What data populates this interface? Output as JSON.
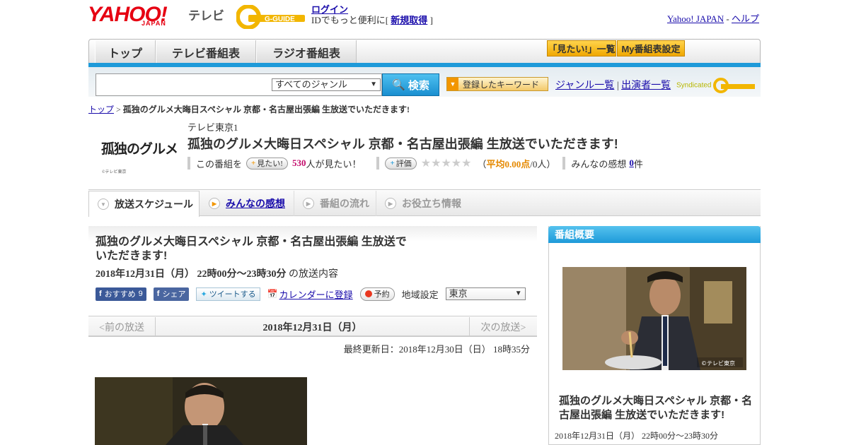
{
  "header": {
    "logo": "YAHOO!",
    "logo_sub": "JAPAN",
    "service": "テレビ",
    "gguide_logo": "G-GUIDE",
    "login_link": "ログイン",
    "login_text_prefix": "IDでもっと便利に[",
    "signup_link": "新規取得",
    "login_text_suffix": "]",
    "yahoo_japan_link": "Yahoo! JAPAN",
    "separator": "-",
    "help_link": "ヘルプ"
  },
  "nav": {
    "tabs": [
      "トップ",
      "テレビ番組表",
      "ラジオ番組表"
    ],
    "want_list": "「見たい!」一覧",
    "my_settings": "My番組表設定"
  },
  "search": {
    "input_value": "",
    "genre_selected": "すべてのジャンル",
    "search_button": "検索",
    "keyword_button": "登録したキーワード",
    "genre_list_link": "ジャンル一覧",
    "divider": "|",
    "performer_list_link": "出演者一覧",
    "syndicated": "Syndicated"
  },
  "breadcrumb": {
    "top": "トップ",
    "sep": ">",
    "current": "孤独のグルメ大晦日スペシャル 京都・名古屋出張編 生放送でいただきます!"
  },
  "program": {
    "logo_text": "孤独のグルメ",
    "logo_copyright": "©テレビ東京",
    "channel": "テレビ東京1",
    "title": "孤独のグルメ大晦日スペシャル 京都・名古屋出張編 生放送でいただきます!",
    "this_program": "この番組を",
    "want_button": "見たい!",
    "want_count": "530",
    "want_suffix": "人が見たい！",
    "rating_button": "評価",
    "stars": "★★★★★",
    "avg_prefix": "（",
    "avg_text": "平均0.00点",
    "avg_suffix": "/0人）",
    "reviews_prefix": "みんなの感想",
    "reviews_count": "0",
    "reviews_suffix": "件"
  },
  "subtabs": [
    "放送スケジュール",
    "みんなの感想",
    "番組の流れ",
    "お役立ち情報"
  ],
  "main": {
    "title": "孤独のグルメ大晦日スペシャル 京都・名古屋出張編 生放送でいただきます!",
    "date_bold": "2018年12月31日（月） 22時00分～23時30分",
    "date_suffix": "の放送内容",
    "fb_recommend": "おすすめ",
    "fb_count": "9",
    "fb_share": "シェア",
    "tweet": "ツイートする",
    "calendar": "カレンダーに登録",
    "reserve": "予約",
    "region_label": "地域設定",
    "region_value": "東京",
    "prev": "<前の放送",
    "pager_date": "2018年12月31日（月）",
    "next": "次の放送>",
    "updated": "最終更新日：2018年12月30日（日） 18時35分"
  },
  "sidebar": {
    "header": "番組概要",
    "photo_credit": "©テレビ東京",
    "title": "孤独のグルメ大晦日スペシャル 京都・名古屋出張編 生放送でいただきます!",
    "date": "2018年12月31日（月） 22時00分～23時30分"
  },
  "colors": {
    "accent_blue": "#1e9ad9",
    "yahoo_red": "#e60012",
    "want_pink": "#c30d6c",
    "avg_orange": "#e58900"
  }
}
